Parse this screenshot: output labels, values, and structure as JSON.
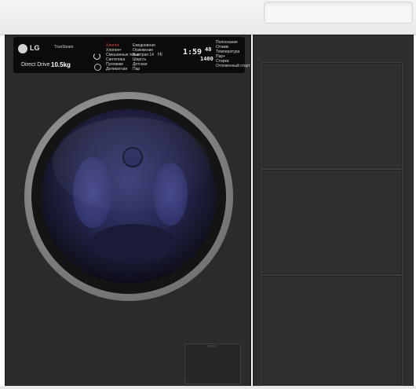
{
  "control_panel": {
    "brand": "LG",
    "feature_badge": "TrueSteam",
    "drive_label": "Direct Drive",
    "capacity": "10.5kg",
    "timer_display": "1:59",
    "spin_display": "1400",
    "temp_display": "40",
    "programs_left": [
      "Хлопок",
      "Хлопок+",
      "Смешанные ткани",
      "Синтетика",
      "Пуховики",
      "Деликатная"
    ],
    "programs_right": [
      "Ежедневная",
      "Освежение",
      "Быстрая 14",
      "Шерсть",
      "Детская",
      "Пар"
    ],
    "option_labels": [
      "Полоскание",
      "Отжим",
      "Температура",
      "Пар+",
      "Стирка",
      "Отложенный старт"
    ]
  },
  "colors": {
    "washer_body": "#2a2b2c",
    "door_ring": "#9a9a9a",
    "door_glass": "#2d2f63",
    "countertop": "#efefef",
    "display_text": "#f2f2f2",
    "accent_red": "#e0443c"
  },
  "icons": {
    "power": "power-icon",
    "program_dial": "dial-icon",
    "wifi": "wifi-icon"
  }
}
